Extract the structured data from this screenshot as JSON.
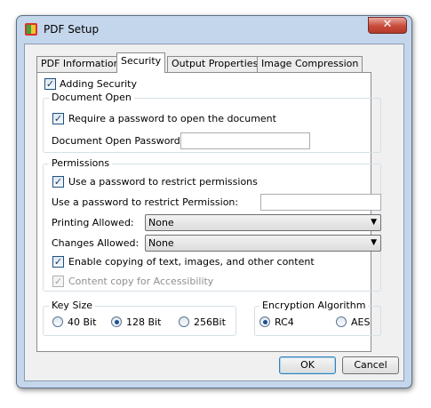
{
  "window": {
    "title": "PDF Setup",
    "close_label": "✕"
  },
  "tabs": [
    "PDF Information",
    "Security",
    "Output Properties",
    "Image Compression"
  ],
  "security": {
    "adding_security": {
      "label": "Adding Security",
      "checked": true
    },
    "document_open": {
      "group_label": "Document Open",
      "require_password": {
        "label": "Require a password to open the document",
        "checked": true
      },
      "password_label": "Document Open Password:",
      "password_value": ""
    },
    "permissions": {
      "group_label": "Permissions",
      "use_password": {
        "label": "Use a password to restrict permissions",
        "checked": true
      },
      "restrict_label": "Use a password to restrict Permission:",
      "restrict_value": "",
      "printing_label": "Printing Allowed:",
      "printing_value": "None",
      "changes_label": "Changes Allowed:",
      "changes_value": "None",
      "copying": {
        "label": "Enable copying of text, images, and other content",
        "checked": true
      },
      "accessibility": {
        "label": "Content copy for Accessibility",
        "checked": true,
        "enabled": false
      }
    },
    "key_size": {
      "group_label": "Key Size",
      "options": [
        "40 Bit",
        "128 Bit",
        "256Bit"
      ],
      "selected": "128 Bit"
    },
    "encryption": {
      "group_label": "Encryption Algorithm",
      "options": [
        "RC4",
        "AES"
      ],
      "selected": "RC4"
    }
  },
  "buttons": {
    "ok": "OK",
    "cancel": "Cancel"
  }
}
